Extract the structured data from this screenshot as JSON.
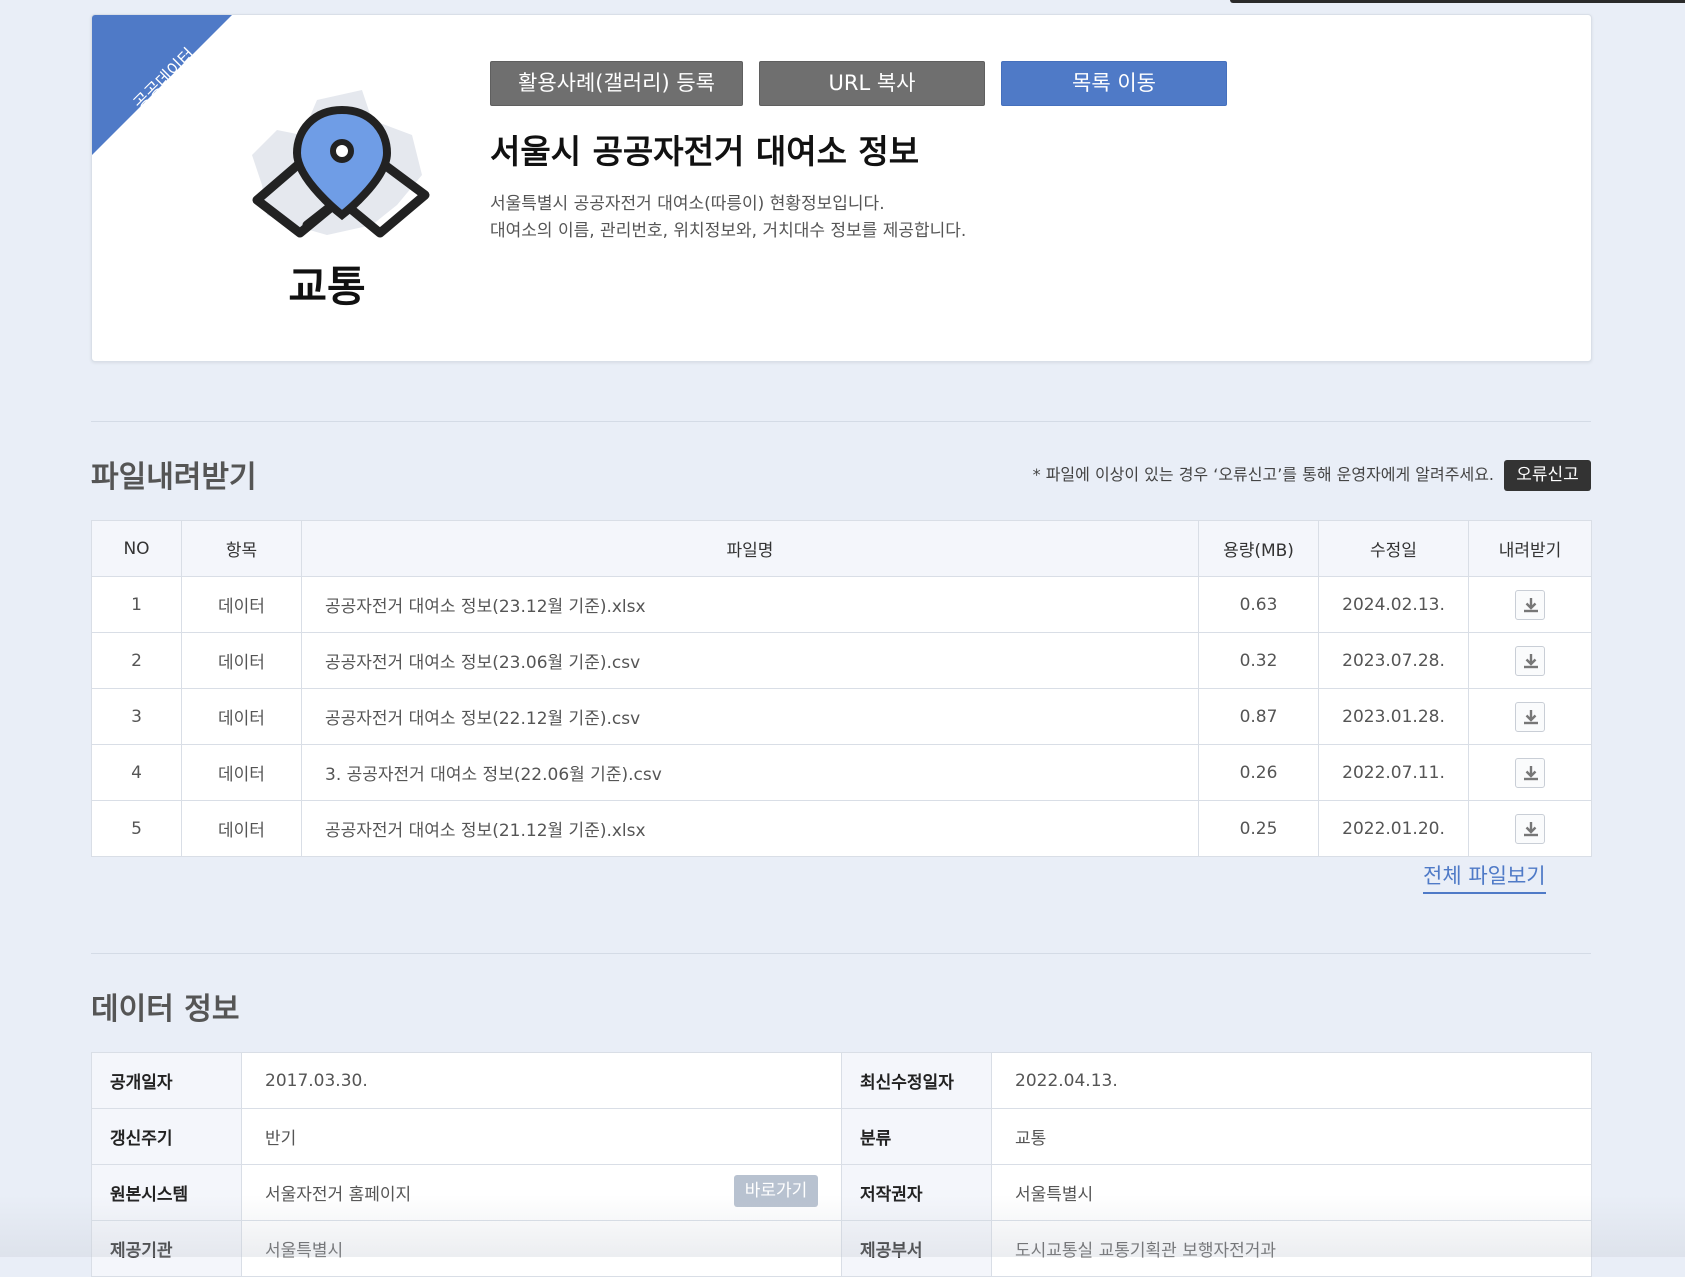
{
  "header": {
    "ribbon_label": "공공데이터",
    "category": "교통",
    "buttons": {
      "gallery": "활용사례(갤러리) 등록",
      "copy_url": "URL 복사",
      "to_list": "목록 이동"
    },
    "title": "서울시 공공자전거 대여소 정보",
    "description_lines": [
      "서울특별시 공공자전거 대여소(따릉이) 현황정보입니다.",
      "대여소의 이름, 관리번호, 위치정보와, 거치대수 정보를 제공합니다."
    ]
  },
  "files": {
    "title": "파일내려받기",
    "notice": "* 파일에 이상이 있는 경우 ‘오류신고’를 통해 운영자에게 알려주세요.",
    "report_label": "오류신고",
    "columns": [
      "NO",
      "항목",
      "파일명",
      "용량(MB)",
      "수정일",
      "내려받기"
    ],
    "rows": [
      {
        "no": "1",
        "type": "데이터",
        "name": "공공자전거 대여소 정보(23.12월 기준).xlsx",
        "size": "0.63",
        "date": "2024.02.13."
      },
      {
        "no": "2",
        "type": "데이터",
        "name": "공공자전거 대여소 정보(23.06월 기준).csv",
        "size": "0.32",
        "date": "2023.07.28."
      },
      {
        "no": "3",
        "type": "데이터",
        "name": "공공자전거 대여소 정보(22.12월 기준).csv",
        "size": "0.87",
        "date": "2023.01.28."
      },
      {
        "no": "4",
        "type": "데이터",
        "name": "3. 공공자전거 대여소 정보(22.06월 기준).csv",
        "size": "0.26",
        "date": "2022.07.11."
      },
      {
        "no": "5",
        "type": "데이터",
        "name": "공공자전거 대여소 정보(21.12월 기준).xlsx",
        "size": "0.25",
        "date": "2022.01.20."
      }
    ],
    "view_all": "전체 파일보기"
  },
  "info": {
    "title": "데이터 정보",
    "rows": [
      {
        "k1": "공개일자",
        "v1": "2017.03.30.",
        "k2": "최신수정일자",
        "v2": "2022.04.13."
      },
      {
        "k1": "갱신주기",
        "v1": "반기",
        "k2": "분류",
        "v2": "교통"
      },
      {
        "k1": "원본시스템",
        "v1": "서울자전거 홈페이지",
        "k2": "저작권자",
        "v2": "서울특별시"
      },
      {
        "k1": "제공기관",
        "v1": "서울특별시",
        "k2": "제공부서",
        "v2": "도시교통실 교통기획관 보행자전거과"
      }
    ],
    "go_label": "바로가기"
  },
  "colors": {
    "accent": "#4f7ac7",
    "gray_button": "#6f6f6f",
    "background": "#e9eef7"
  }
}
